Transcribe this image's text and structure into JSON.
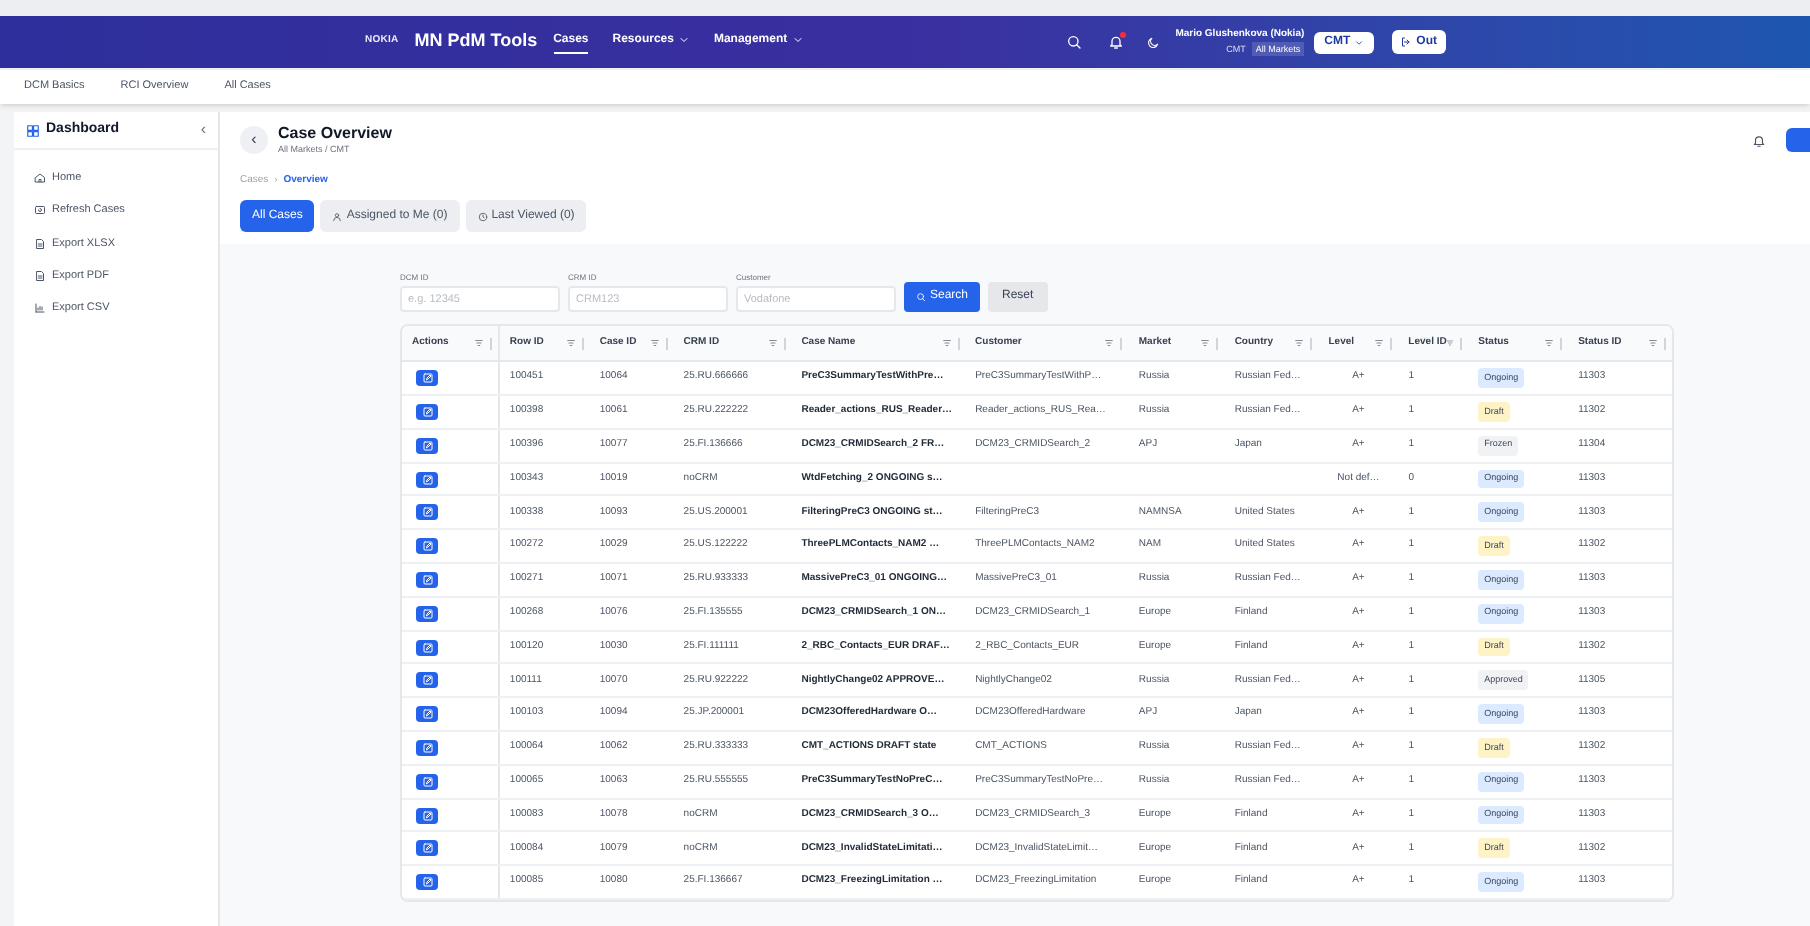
{
  "navbar": {
    "logo": "NOKIA",
    "app_title": "MN PdM Tools",
    "links": [
      {
        "label": "Cases",
        "selected": true,
        "dropdown": false
      },
      {
        "label": "Resources",
        "selected": false,
        "dropdown": true
      },
      {
        "label": "Management",
        "selected": false,
        "dropdown": true
      }
    ],
    "notification_dot": true,
    "user_name": "Mario Glushenkova (Nokia)",
    "user_role": "CMT",
    "user_scope": "All Markets",
    "role_button": "CMT",
    "logout_button": "Out"
  },
  "top_tabs": [
    "DCM Basics",
    "RCI Overview",
    "All Cases"
  ],
  "sidebar": {
    "title": "Dashboard",
    "collapse": "‹",
    "items": [
      {
        "label": "Home"
      },
      {
        "label": "Refresh Cases"
      },
      {
        "label": "Export XLSX"
      },
      {
        "label": "Export PDF"
      },
      {
        "label": "Export CSV"
      }
    ]
  },
  "header": {
    "back": "‹",
    "title": "Case Overview",
    "subtitle": "All Markets / CMT"
  },
  "breadcrumb": {
    "separator": "›",
    "items": [
      {
        "label": "Cases",
        "selected": false
      },
      {
        "label": "Overview",
        "selected": true
      }
    ]
  },
  "view_tabs": [
    {
      "label": "All Cases",
      "selected": true
    },
    {
      "label": "Assigned to Me (0)",
      "selected": false
    },
    {
      "label": "Last Viewed (0)",
      "selected": false
    }
  ],
  "filters": [
    {
      "label": "DCM ID",
      "placeholder": "e.g. 12345"
    },
    {
      "label": "CRM ID",
      "placeholder": "CRM123"
    },
    {
      "label": "Customer",
      "placeholder": "Vodafone"
    }
  ],
  "search_button": "Search",
  "reset_button": "Reset",
  "table": {
    "columns": [
      "Actions",
      "Row ID",
      "Case ID",
      "CRM ID",
      "Case Name",
      "Customer",
      "Market",
      "Country",
      "Level",
      "Level ID",
      "Status",
      "Status ID"
    ],
    "rows": [
      {
        "row_id": "100451",
        "case_id": "10064",
        "crm_id": "25.RU.666666",
        "case_name": "PreC3SummaryTestWithPre…",
        "customer": "PreC3SummaryTestWithP…",
        "market": "Russia",
        "country": "Russian Fed…",
        "level": "A+",
        "level_id": "1",
        "status": "Ongoing",
        "color": "#dbeafe",
        "status_id": "11303"
      },
      {
        "row_id": "100398",
        "case_id": "10061",
        "crm_id": "25.RU.222222",
        "case_name": "Reader_actions_RUS_Reader…",
        "customer": "Reader_actions_RUS_Rea…",
        "market": "Russia",
        "country": "Russian Fed…",
        "level": "A+",
        "level_id": "1",
        "status": "Draft",
        "color": "#fef3c7",
        "status_id": "11302"
      },
      {
        "row_id": "100396",
        "case_id": "10077",
        "crm_id": "25.FI.136666",
        "case_name": "DCM23_CRMIDSearch_2 FR…",
        "customer": "DCM23_CRMIDSearch_2",
        "market": "APJ",
        "country": "Japan",
        "level": "A+",
        "level_id": "1",
        "status": "Frozen",
        "color": "#f1f2f4",
        "status_id": "11304"
      },
      {
        "row_id": "100343",
        "case_id": "10019",
        "crm_id": "noCRM",
        "case_name": "WtdFetching_2 ONGOING s…",
        "level": "Not def…",
        "level_id": "0",
        "status": "Ongoing",
        "color": "#dbeafe",
        "status_id": "11303"
      },
      {
        "row_id": "100338",
        "case_id": "10093",
        "crm_id": "25.US.200001",
        "case_name": "FilteringPreC3 ONGOING st…",
        "customer": "FilteringPreC3",
        "market": "NAMNSA",
        "country": "United States",
        "level": "A+",
        "level_id": "1",
        "status": "Ongoing",
        "color": "#dbeafe",
        "status_id": "11303"
      },
      {
        "row_id": "100272",
        "case_id": "10029",
        "crm_id": "25.US.122222",
        "case_name": "ThreePLMContacts_NAM2 …",
        "customer": "ThreePLMContacts_NAM2",
        "market": "NAM",
        "country": "United States",
        "level": "A+",
        "level_id": "1",
        "status": "Draft",
        "color": "#fef3c7",
        "status_id": "11302"
      },
      {
        "row_id": "100271",
        "case_id": "10071",
        "crm_id": "25.RU.933333",
        "case_name": "MassivePreC3_01 ONGOING…",
        "customer": "MassivePreC3_01",
        "market": "Russia",
        "country": "Russian Fed…",
        "level": "A+",
        "level_id": "1",
        "status": "Ongoing",
        "color": "#dbeafe",
        "status_id": "11303"
      },
      {
        "row_id": "100268",
        "case_id": "10076",
        "crm_id": "25.FI.135555",
        "case_name": "DCM23_CRMIDSearch_1 ON…",
        "customer": "DCM23_CRMIDSearch_1",
        "market": "Europe",
        "country": "Finland",
        "level": "A+",
        "level_id": "1",
        "status": "Ongoing",
        "color": "#dbeafe",
        "status_id": "11303"
      },
      {
        "row_id": "100120",
        "case_id": "10030",
        "crm_id": "25.FI.111111",
        "case_name": "2_RBC_Contacts_EUR DRAF…",
        "customer": "2_RBC_Contacts_EUR",
        "market": "Europe",
        "country": "Finland",
        "level": "A+",
        "level_id": "1",
        "status": "Draft",
        "color": "#fef3c7",
        "status_id": "11302"
      },
      {
        "row_id": "100111",
        "case_id": "10070",
        "crm_id": "25.RU.922222",
        "case_name": "NightlyChange02 APPROVE…",
        "customer": "NightlyChange02",
        "market": "Russia",
        "country": "Russian Fed…",
        "level": "A+",
        "level_id": "1",
        "status": "Approved",
        "color": "#f1f2f4",
        "status_id": "11305"
      },
      {
        "row_id": "100103",
        "case_id": "10094",
        "crm_id": "25.JP.200001",
        "case_name": "DCM23OfferedHardware O…",
        "customer": "DCM23OfferedHardware",
        "market": "APJ",
        "country": "Japan",
        "level": "A+",
        "level_id": "1",
        "status": "Ongoing",
        "color": "#dbeafe",
        "status_id": "11303"
      },
      {
        "row_id": "100064",
        "case_id": "10062",
        "crm_id": "25.RU.333333",
        "case_name": "CMT_ACTIONS DRAFT state",
        "customer": "CMT_ACTIONS",
        "market": "Russia",
        "country": "Russian Fed…",
        "level": "A+",
        "level_id": "1",
        "status": "Draft",
        "color": "#fef3c7",
        "status_id": "11302"
      },
      {
        "row_id": "100065",
        "case_id": "10063",
        "crm_id": "25.RU.555555",
        "case_name": "PreC3SummaryTestNoPreC…",
        "customer": "PreC3SummaryTestNoPre…",
        "market": "Russia",
        "country": "Russian Fed…",
        "level": "A+",
        "level_id": "1",
        "status": "Ongoing",
        "color": "#dbeafe",
        "status_id": "11303"
      },
      {
        "row_id": "100083",
        "case_id": "10078",
        "crm_id": "noCRM",
        "case_name": "DCM23_CRMIDSearch_3 O…",
        "customer": "DCM23_CRMIDSearch_3",
        "market": "Europe",
        "country": "Finland",
        "level": "A+",
        "level_id": "1",
        "status": "Ongoing",
        "color": "#dbeafe",
        "status_id": "11303"
      },
      {
        "row_id": "100084",
        "case_id": "10079",
        "crm_id": "noCRM",
        "case_name": "DCM23_InvalidStateLimitati…",
        "customer": "DCM23_InvalidStateLimit…",
        "market": "Europe",
        "country": "Finland",
        "level": "A+",
        "level_id": "1",
        "status": "Draft",
        "color": "#fef3c7",
        "status_id": "11302"
      },
      {
        "row_id": "100085",
        "case_id": "10080",
        "crm_id": "25.FI.136667",
        "case_name": "DCM23_FreezingLimitation …",
        "customer": "DCM23_FreezingLimitation",
        "market": "Europe",
        "country": "Finland",
        "level": "A+",
        "level_id": "1",
        "status": "Ongoing",
        "color": "#dbeafe",
        "status_id": "11303"
      }
    ]
  }
}
